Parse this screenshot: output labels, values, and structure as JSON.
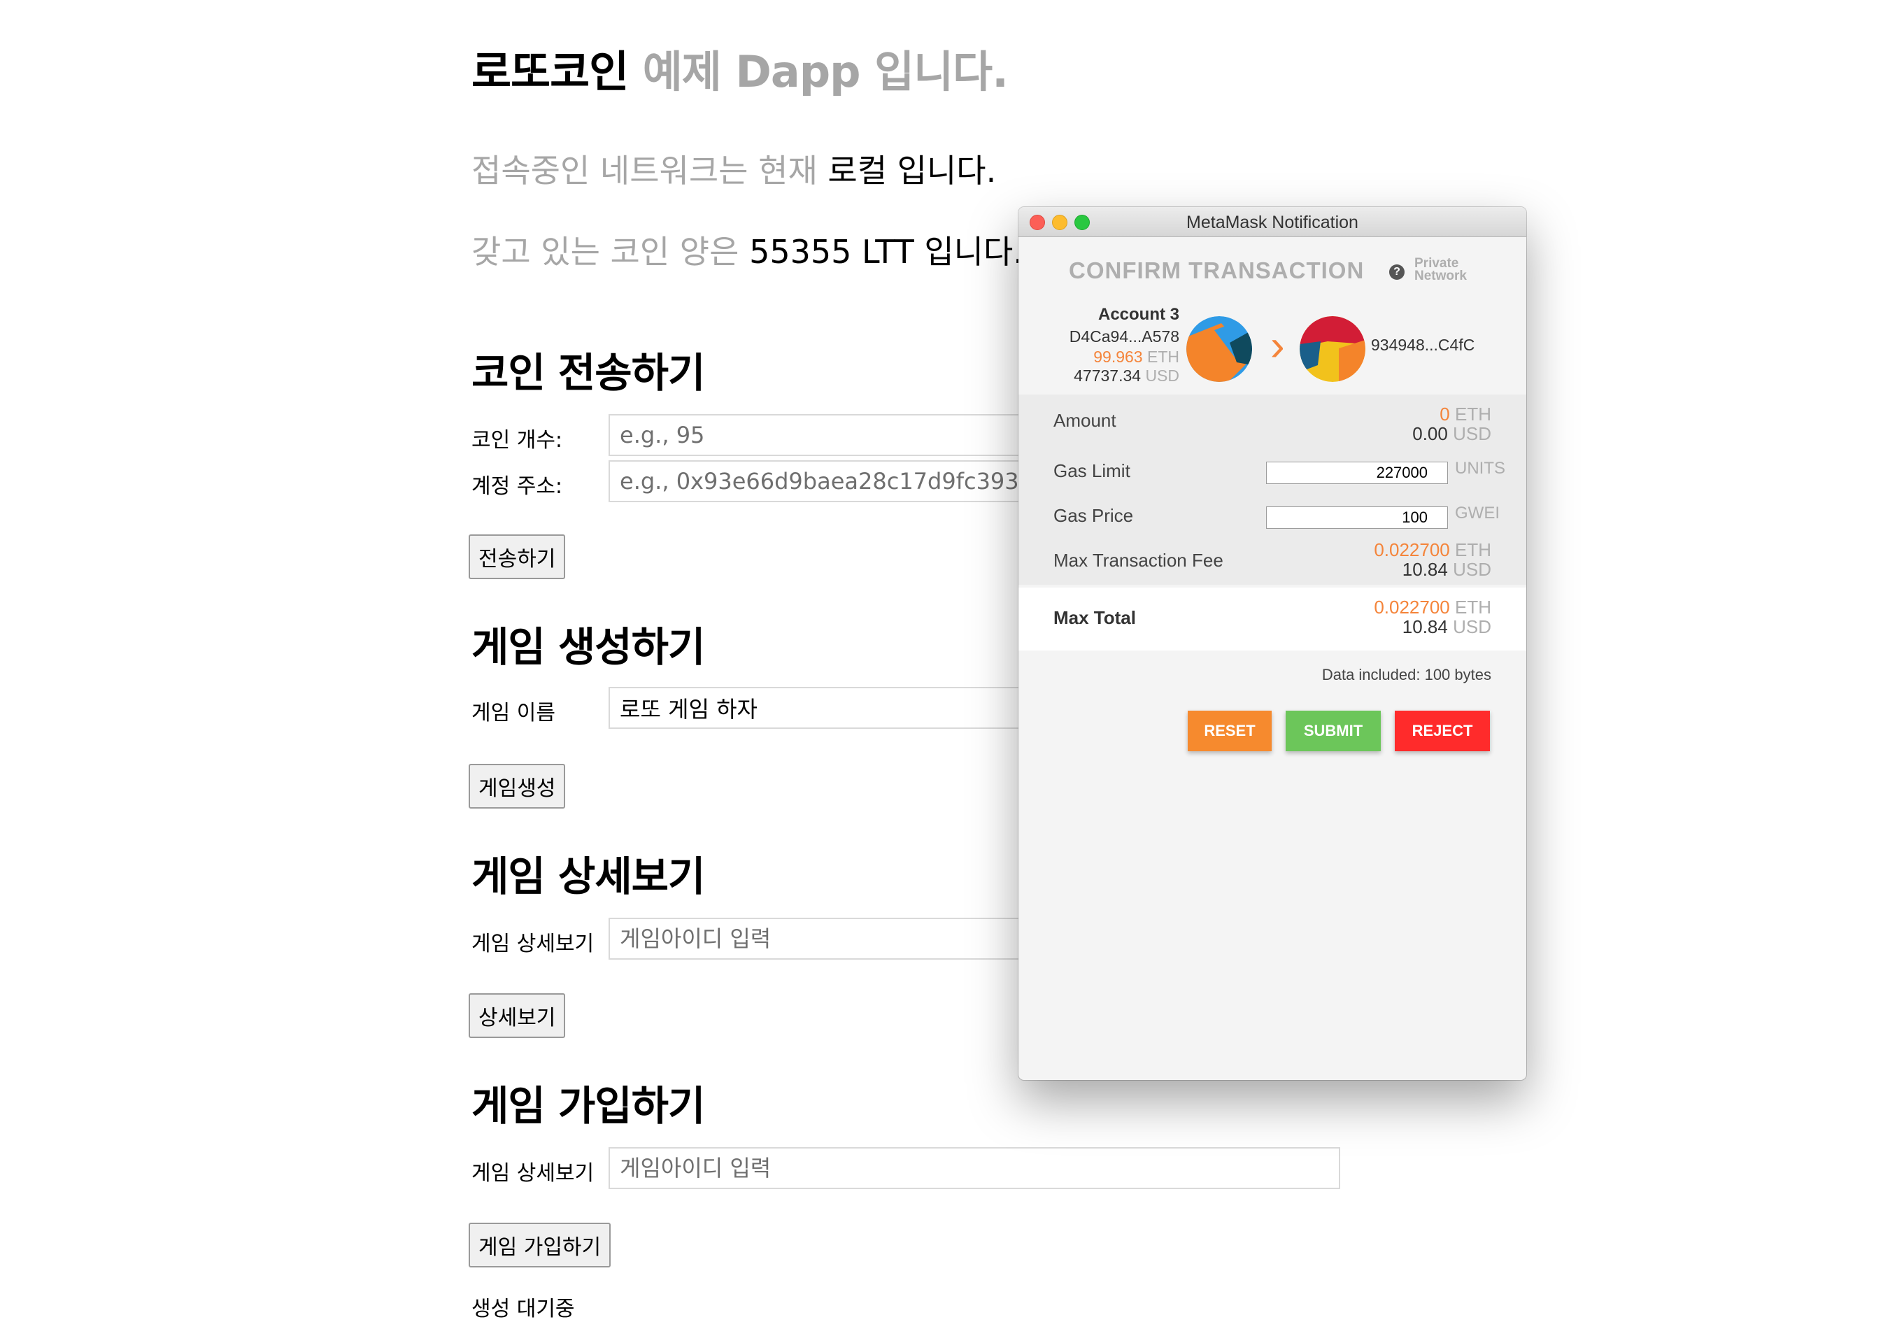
{
  "page": {
    "title_strong": "로또코인",
    "title_muted": "예제 Dapp 입니다.",
    "network_muted": "접속중인 네트워크는 현재",
    "network_value": "로컬 입니다.",
    "balance_muted": "갖고 있는 코인 양은",
    "balance_value": "55355 LTT 입니다.",
    "send": {
      "heading": "코인 전송하기",
      "count_label": "코인 개수:",
      "count_placeholder": "e.g., 95",
      "address_label": "계정 주소:",
      "address_placeholder": "e.g., 0x93e66d9baea28c17d9fc393b53e3fbdd76899dae",
      "button": "전송하기"
    },
    "create": {
      "heading": "게임 생성하기",
      "name_label": "게임 이름",
      "name_value": "로또 게임 하자",
      "button": "게임생성"
    },
    "detail": {
      "heading": "게임 상세보기",
      "label": "게임 상세보기",
      "placeholder": "게임아이디 입력",
      "button": "상세보기"
    },
    "join": {
      "heading": "게임 가입하기",
      "label": "게임 상세보기",
      "placeholder": "게임아이디 입력",
      "button": "게임 가입하기"
    },
    "status": "생성 대기중"
  },
  "metamask": {
    "window_title": "MetaMask Notification",
    "heading": "CONFIRM TRANSACTION",
    "network_line1": "Private",
    "network_line2": "Network",
    "from": {
      "name": "Account 3",
      "address": "D4Ca94...A578",
      "eth": "99.963",
      "eth_unit": "ETH",
      "usd": "47737.34",
      "usd_unit": "USD"
    },
    "to_address": "934948...C4fC",
    "amount": {
      "label": "Amount",
      "eth": "0",
      "eth_unit": "ETH",
      "usd": "0.00",
      "usd_unit": "USD"
    },
    "gas_limit": {
      "label": "Gas Limit",
      "value": "227000",
      "unit": "UNITS"
    },
    "gas_price": {
      "label": "Gas Price",
      "value": "100",
      "unit": "GWEI"
    },
    "max_fee": {
      "label": "Max Transaction Fee",
      "eth": "0.022700",
      "eth_unit": "ETH",
      "usd": "10.84",
      "usd_unit": "USD"
    },
    "max_total": {
      "label": "Max Total",
      "eth": "0.022700",
      "eth_unit": "ETH",
      "usd": "10.84",
      "usd_unit": "USD"
    },
    "data_info": "Data included: 100 bytes",
    "buttons": {
      "reset": "RESET",
      "submit": "SUBMIT",
      "reject": "REJECT"
    },
    "colors": {
      "accent": "#f4843a",
      "reset": "#f68a2e",
      "submit": "#6cc65a",
      "reject": "#ff2b2b"
    }
  }
}
